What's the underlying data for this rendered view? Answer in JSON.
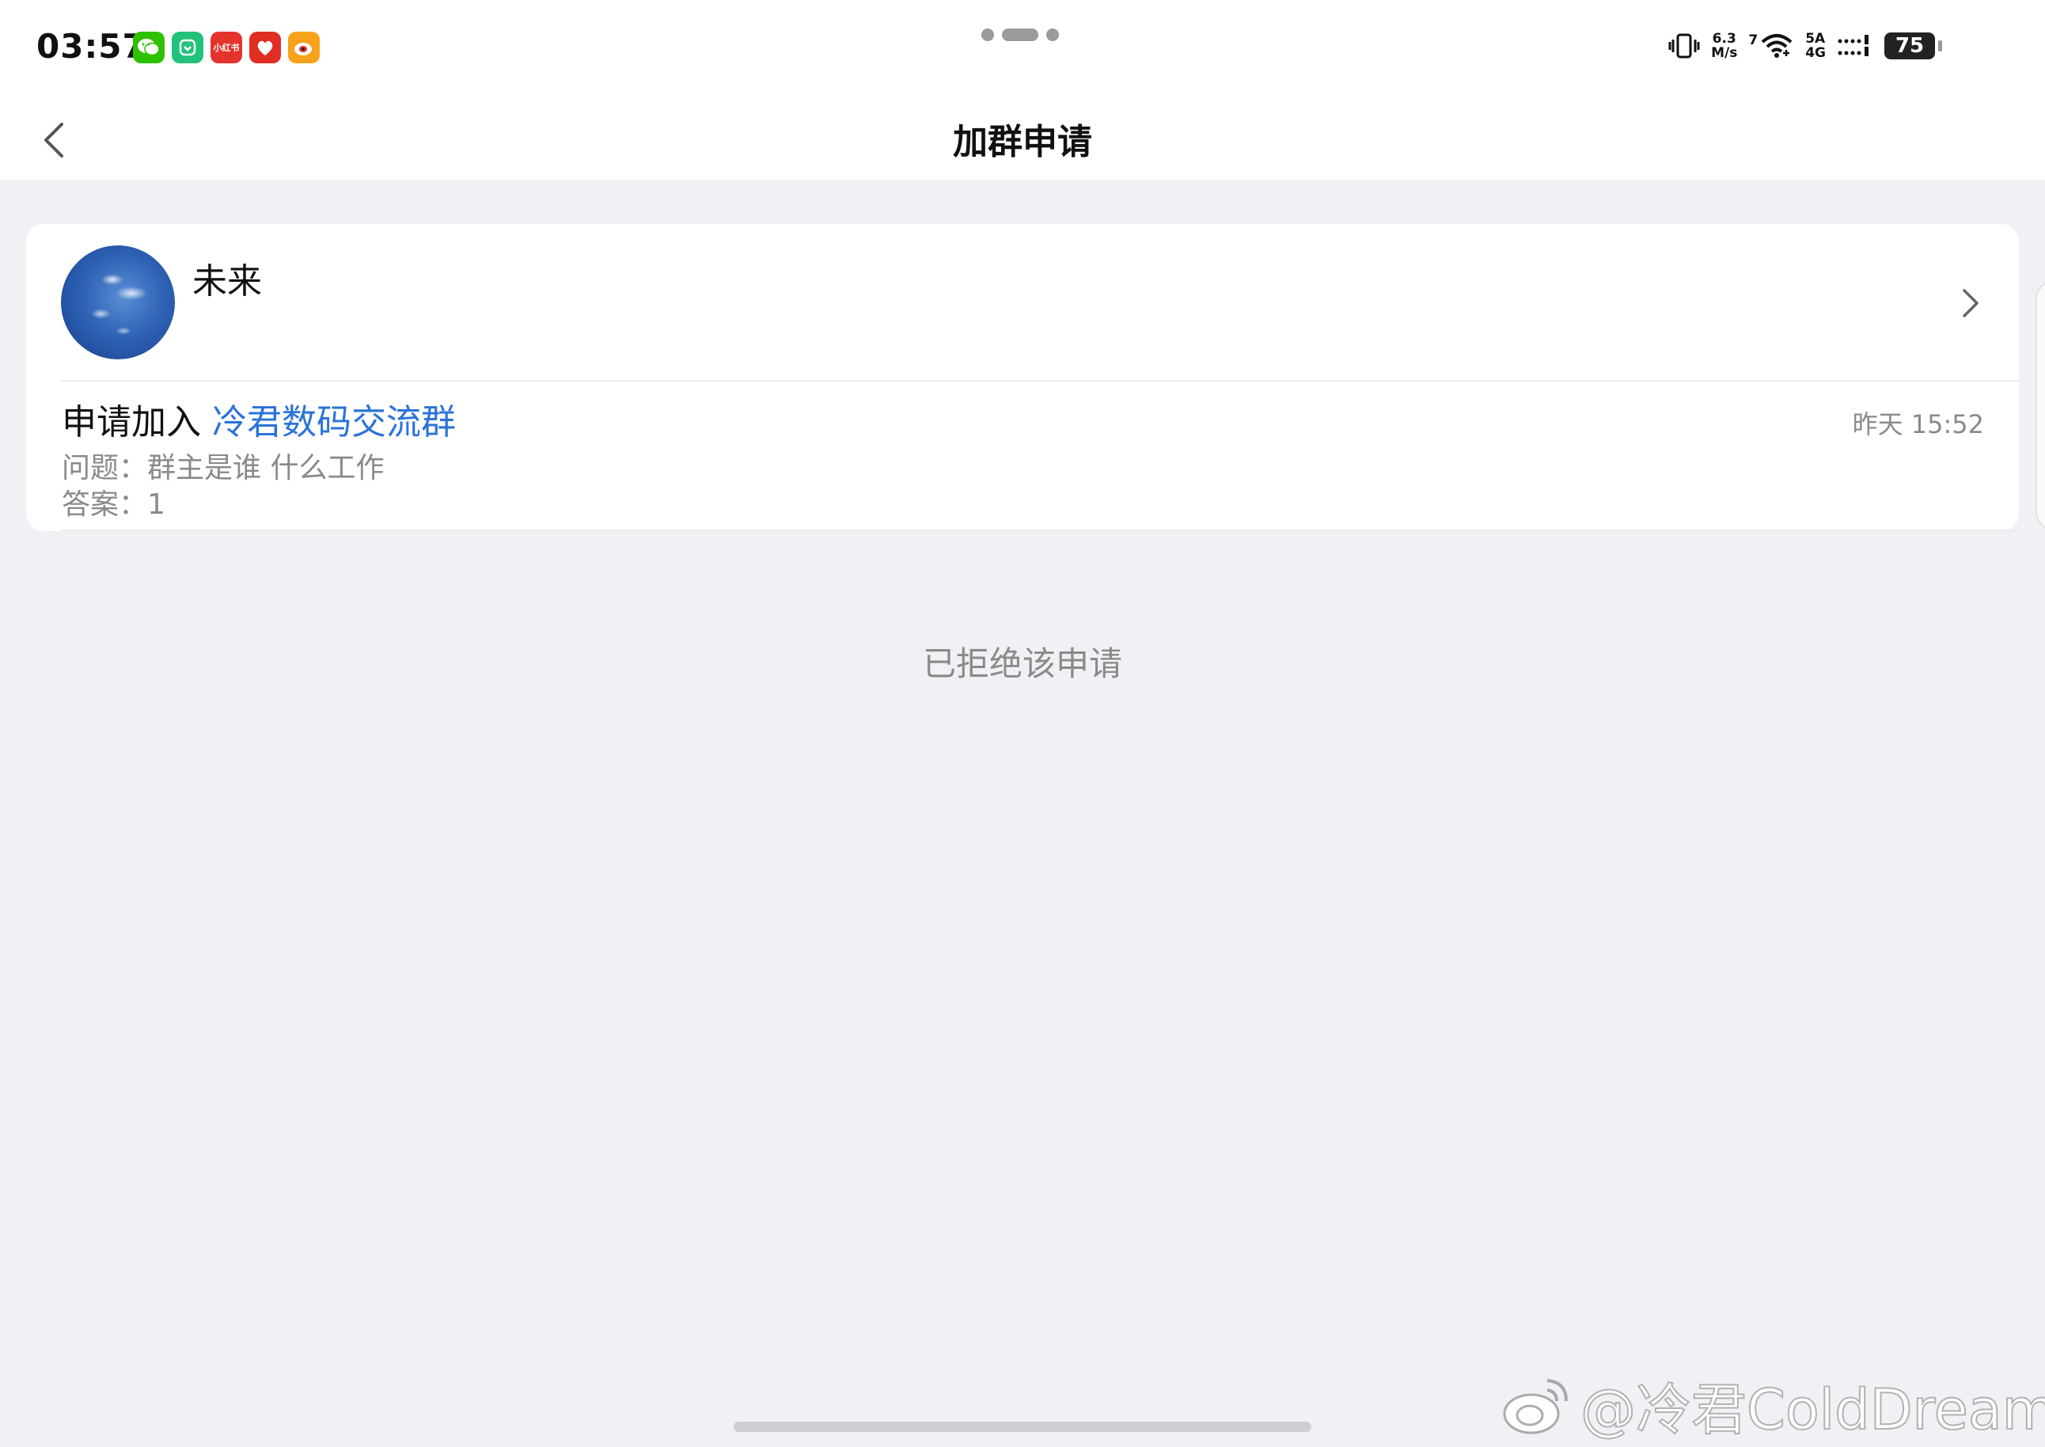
{
  "status_bar": {
    "time": "03:57",
    "notification_icons": [
      {
        "name": "wechat-icon",
        "color": "#2dc100",
        "label": ""
      },
      {
        "name": "mijia-icon",
        "color": "#22c27a",
        "label": ""
      },
      {
        "name": "xiaohongshu-icon",
        "color": "#e4322c",
        "label": "小红书"
      },
      {
        "name": "pinduoduo-icon",
        "color": "#e02e24",
        "label": ""
      },
      {
        "name": "weibo-icon",
        "color": "#f6a21a",
        "label": ""
      }
    ],
    "net_speed_value": "6.3",
    "net_speed_unit": "M/s",
    "wifi_badge": "7",
    "network_top": "5A",
    "network_bottom": "4G",
    "battery": "75"
  },
  "nav": {
    "title": "加群申请"
  },
  "request": {
    "user_name": "未来",
    "apply_prefix": "申请加入",
    "group_name": "冷君数码交流群",
    "question_line": "问题：群主是谁 什么工作",
    "answer_line": "答案：1",
    "timestamp": "昨天 15:52"
  },
  "status_text": "已拒绝该申请",
  "watermark": "@冷君ColdDream",
  "colors": {
    "accent_link": "#2b73d8",
    "background": "#f1f1f5",
    "secondary_text": "#8a8a8a"
  }
}
